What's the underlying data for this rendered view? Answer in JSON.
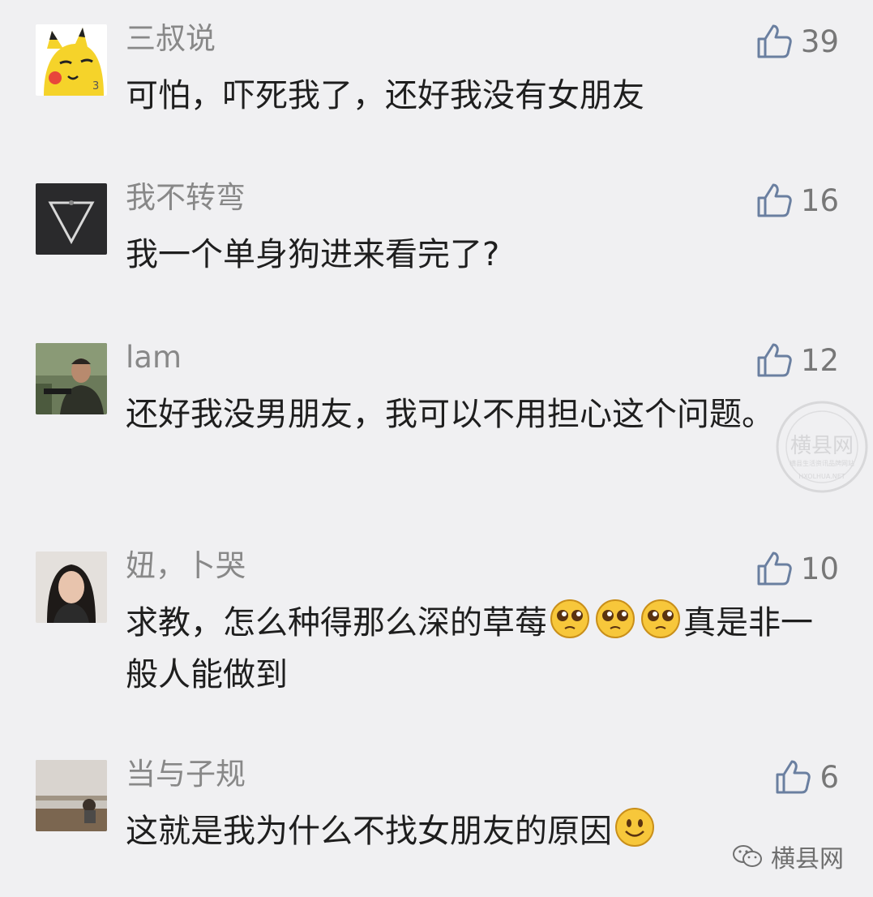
{
  "comments": [
    {
      "username": "三叔说",
      "likes": "39",
      "text": "可怕，吓死我了，还好我没有女朋友",
      "avatar": "pikachu-avatar"
    },
    {
      "username": "我不转弯",
      "likes": "16",
      "text": "我一个单身狗进来看完了?",
      "avatar": "triangle-avatar"
    },
    {
      "username": "lam",
      "likes": "12",
      "text": "还好我没男朋友，我可以不用担心这个问题。",
      "avatar": "photo-man-avatar"
    },
    {
      "username": "妞，卜哭",
      "likes": "10",
      "text_before": "求教，怎么种得那么深的草莓",
      "text_after": "真是非一般人能做到",
      "avatar": "photo-woman-avatar",
      "emoji": "pleading-emoji"
    },
    {
      "username": "当与子规",
      "likes": "6",
      "text": "这就是我为什么不找女朋友的原因",
      "avatar": "sunset-avatar",
      "emoji": "smile-emoji"
    }
  ],
  "watermark": {
    "text": "横县网",
    "sub": "横县生活资讯品牌网站",
    "url": "HXOLHUA.NET"
  },
  "footer": {
    "brand": "横县网",
    "icon": "wechat-icon"
  },
  "colors": {
    "background": "#f0f0f2",
    "username": "#888888",
    "text": "#1e1e1e",
    "like": "#6a7fa0"
  }
}
